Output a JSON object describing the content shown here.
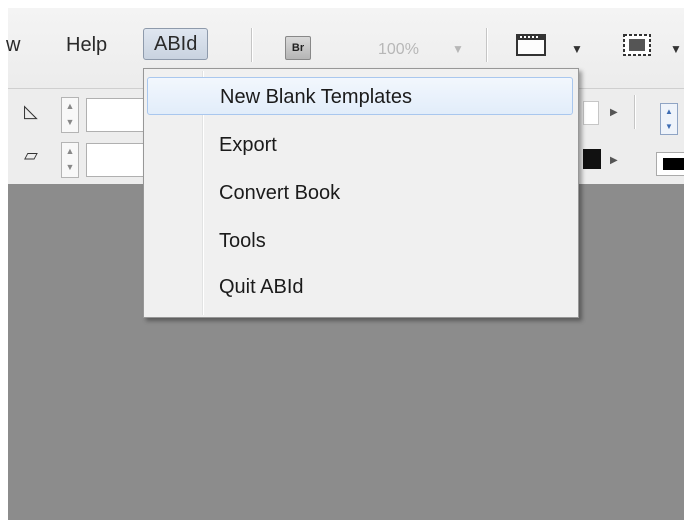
{
  "menubar": {
    "view_fragment": "w",
    "help": "Help",
    "abid": "ABId",
    "br_label": "Br",
    "zoom": "100%"
  },
  "abid_menu": {
    "items": [
      {
        "label": "New Blank Templates"
      },
      {
        "label": "Export"
      },
      {
        "label": "Convert Book"
      },
      {
        "label": "Tools"
      },
      {
        "label": "Quit ABId"
      }
    ]
  },
  "colors": {
    "canvas": "#8c8c8c",
    "highlight_border": "#a9c7ee"
  }
}
